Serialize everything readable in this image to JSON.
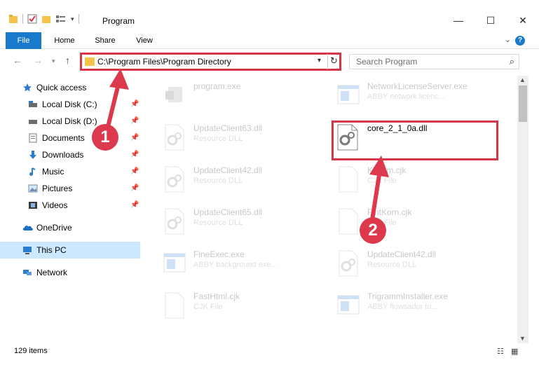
{
  "window": {
    "title": "Program",
    "buttons": {
      "minimize": "—",
      "maximize": "☐",
      "close": "✕"
    }
  },
  "ribbon": {
    "tabs": [
      "File",
      "Home",
      "Share",
      "View"
    ],
    "help": "?"
  },
  "navigation": {
    "address_path": "C:\\Program Files\\Program Directory",
    "search_placeholder": "Search Program"
  },
  "sidebar": {
    "quick_access": "Quick access",
    "items": [
      {
        "label": "Local Disk (C:)",
        "icon": "drive-icon",
        "pinned": true
      },
      {
        "label": "Local Disk (D:)",
        "icon": "drive-icon",
        "pinned": true
      },
      {
        "label": "Documents",
        "icon": "documents-icon",
        "pinned": true
      },
      {
        "label": "Downloads",
        "icon": "downloads-icon",
        "pinned": true
      },
      {
        "label": "Music",
        "icon": "music-icon",
        "pinned": true
      },
      {
        "label": "Pictures",
        "icon": "pictures-icon",
        "pinned": true
      },
      {
        "label": "Videos",
        "icon": "videos-icon",
        "pinned": true
      }
    ],
    "onedrive": "OneDrive",
    "this_pc": "This PC",
    "network": "Network"
  },
  "files": [
    {
      "name": "program.exe",
      "desc": "",
      "type": "exe",
      "faded": true
    },
    {
      "name": "NetworkLicenseServer.exe",
      "desc": "ABBY network licenc...",
      "type": "exe-window",
      "faded": true
    },
    {
      "name": "UpdateClient63.dll",
      "desc": "Resource DLL",
      "type": "dll",
      "faded": true
    },
    {
      "name": "core_2_1_0a.dll",
      "desc": "",
      "type": "dll",
      "faded": false
    },
    {
      "name": "UpdateClient42.dll",
      "desc": "Resource DLL",
      "type": "dll",
      "faded": true
    },
    {
      "name": "Ki...om.cjk",
      "desc": "CJK File",
      "type": "file",
      "faded": true
    },
    {
      "name": "UpdateClient65.dll",
      "desc": "Resource DLL",
      "type": "dll",
      "faded": true
    },
    {
      "name": "FintKorn.cjk",
      "desc": "CJK File",
      "type": "file",
      "faded": true
    },
    {
      "name": "FineExec.exe",
      "desc": "ABBY background exe...",
      "type": "exe-window",
      "faded": true
    },
    {
      "name": "UpdateClient42.dll",
      "desc": "Resource DLL",
      "type": "dll",
      "faded": true
    },
    {
      "name": "FastHtml.cjk",
      "desc": "CJK File",
      "type": "file",
      "faded": true
    },
    {
      "name": "TrigrammInstaller.exe",
      "desc": "ABBY fiowsador to...",
      "type": "exe-window",
      "faded": true
    }
  ],
  "status": {
    "item_count": "129 items"
  },
  "annotations": {
    "step1": "1",
    "step2": "2"
  },
  "colors": {
    "accent": "#1979ca",
    "highlight": "#d9364a",
    "selection": "#cce8ff",
    "folder": "#f5c44a"
  }
}
